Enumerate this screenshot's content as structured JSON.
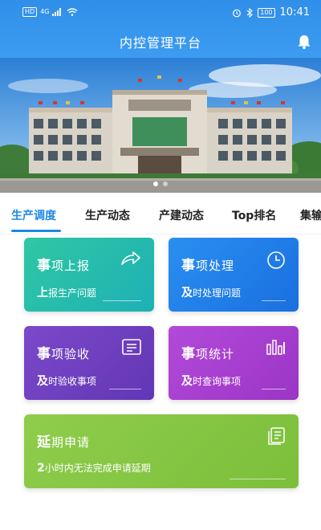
{
  "status_bar": {
    "hd": "HD",
    "signal_text": "4G",
    "battery": "100",
    "time": "10:41"
  },
  "app": {
    "title": "内控管理平台"
  },
  "tabs": [
    {
      "label": "生产调度",
      "active": true
    },
    {
      "label": "生产动态",
      "active": false
    },
    {
      "label": "产建动态",
      "active": false
    },
    {
      "label": "Top排名",
      "active": false
    },
    {
      "label": "集输",
      "active": false
    }
  ],
  "cards": [
    {
      "title_first": "事",
      "title_rest": "项上报",
      "sub_first": "上",
      "sub_rest": "报生产问题",
      "icon": "share-arrow-icon"
    },
    {
      "title_first": "事",
      "title_rest": "项处理",
      "sub_first": "及",
      "sub_rest": "时处理问题",
      "icon": "clock-icon"
    },
    {
      "title_first": "事",
      "title_rest": "项验收",
      "sub_first": "及",
      "sub_rest": "时验收事项",
      "icon": "list-board-icon"
    },
    {
      "title_first": "事",
      "title_rest": "项统计",
      "sub_first": "及",
      "sub_rest": "时查询事项",
      "icon": "bar-chart-icon"
    },
    {
      "title_first": "延",
      "title_rest": "期申请",
      "sub_first": "2",
      "sub_rest": "小时内无法完成申请延期",
      "icon": "document-icon"
    }
  ],
  "colors": {
    "header": "#3d9cf0",
    "tab_active": "#1e88e5",
    "card_report": "#22b9b0",
    "card_process": "#2180ea",
    "card_accept": "#6e40c0",
    "card_stats": "#a93fd0",
    "card_delay": "#86c744"
  }
}
